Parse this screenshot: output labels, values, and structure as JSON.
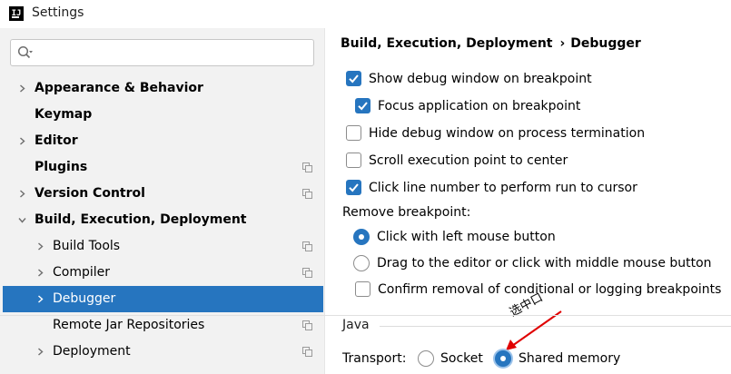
{
  "window": {
    "title": "Settings",
    "logo_text": "IJ"
  },
  "search": {
    "placeholder": "",
    "value": ""
  },
  "tree": [
    {
      "label": "Appearance & Behavior",
      "bold": true,
      "expandable": true,
      "expanded": false,
      "depth": 0,
      "project_icon": false
    },
    {
      "label": "Keymap",
      "bold": true,
      "expandable": false,
      "depth": 0,
      "project_icon": false
    },
    {
      "label": "Editor",
      "bold": true,
      "expandable": true,
      "expanded": false,
      "depth": 0,
      "project_icon": false
    },
    {
      "label": "Plugins",
      "bold": true,
      "expandable": false,
      "depth": 0,
      "project_icon": true
    },
    {
      "label": "Version Control",
      "bold": true,
      "expandable": true,
      "expanded": false,
      "depth": 0,
      "project_icon": true
    },
    {
      "label": "Build, Execution, Deployment",
      "bold": true,
      "expandable": true,
      "expanded": true,
      "depth": 0,
      "project_icon": false
    },
    {
      "label": "Build Tools",
      "bold": false,
      "expandable": true,
      "expanded": false,
      "depth": 1,
      "project_icon": true
    },
    {
      "label": "Compiler",
      "bold": false,
      "expandable": true,
      "expanded": false,
      "depth": 1,
      "project_icon": true
    },
    {
      "label": "Debugger",
      "bold": false,
      "expandable": true,
      "expanded": false,
      "depth": 1,
      "project_icon": false,
      "selected": true
    },
    {
      "label": "Remote Jar Repositories",
      "bold": false,
      "expandable": false,
      "depth": 1,
      "project_icon": true
    },
    {
      "label": "Deployment",
      "bold": false,
      "expandable": true,
      "expanded": false,
      "depth": 1,
      "project_icon": true
    }
  ],
  "breadcrumb": {
    "parent": "Build, Execution, Deployment",
    "separator": "›",
    "current": "Debugger"
  },
  "options": {
    "show_debug_window": {
      "label": "Show debug window on breakpoint",
      "checked": true
    },
    "focus_application": {
      "label": "Focus application on breakpoint",
      "checked": true
    },
    "hide_debug_window": {
      "label": "Hide debug window on process termination",
      "checked": false
    },
    "scroll_execution_point": {
      "label": "Scroll execution point to center",
      "checked": false
    },
    "click_line_number": {
      "label": "Click line number to perform run to cursor",
      "checked": true
    }
  },
  "remove_breakpoint": {
    "heading": "Remove breakpoint:",
    "left_click": {
      "label": "Click with left mouse button",
      "selected": true
    },
    "drag_to_editor": {
      "label": "Drag to the editor or click with middle mouse button",
      "selected": false
    },
    "confirm_removal": {
      "label": "Confirm removal of conditional or logging breakpoints",
      "checked": false
    }
  },
  "java": {
    "section_title": "Java",
    "transport_label": "Transport:",
    "socket": {
      "label": "Socket",
      "selected": false
    },
    "shared_memory": {
      "label": "Shared memory",
      "selected": true
    }
  },
  "annotation": {
    "text": "选中口",
    "color": "#e00000"
  },
  "colors": {
    "accent": "#2675bf",
    "sidebar_bg": "#f2f2f2",
    "selection_text": "#ffffff"
  }
}
